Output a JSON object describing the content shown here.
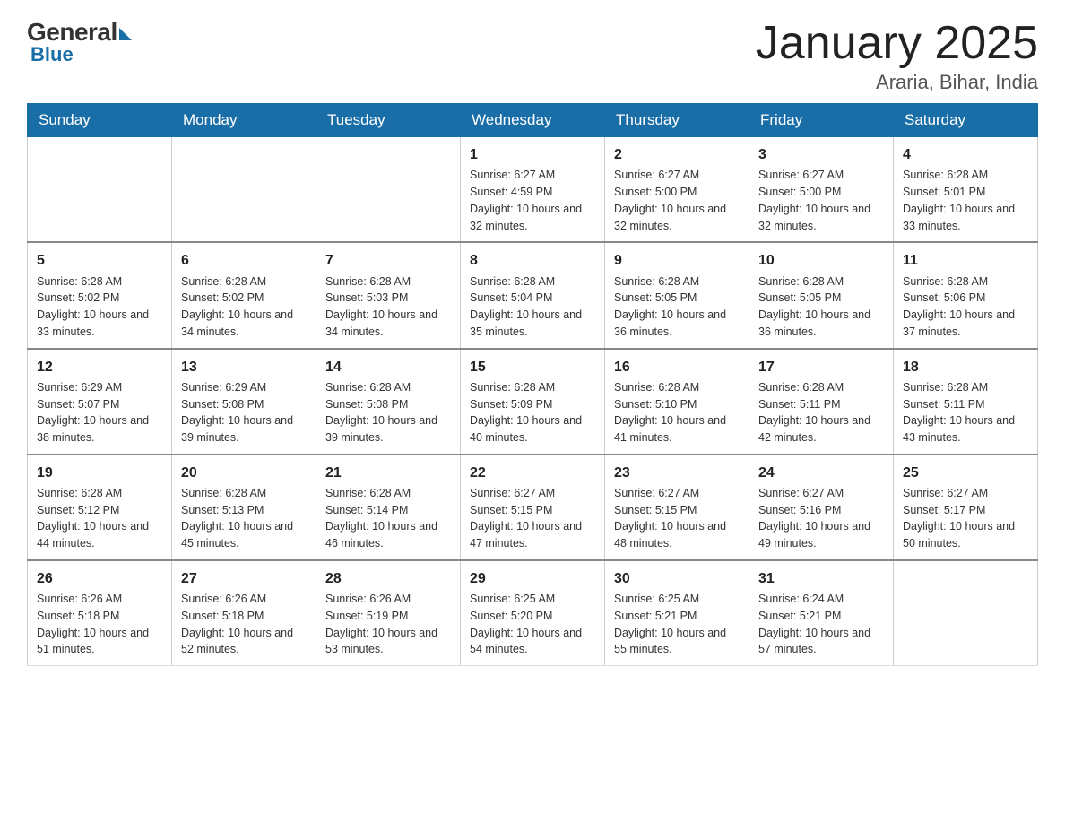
{
  "header": {
    "logo_general": "General",
    "logo_blue": "Blue",
    "month_title": "January 2025",
    "location": "Araria, Bihar, India"
  },
  "days_of_week": [
    "Sunday",
    "Monday",
    "Tuesday",
    "Wednesday",
    "Thursday",
    "Friday",
    "Saturday"
  ],
  "weeks": [
    [
      {
        "day": "",
        "info": ""
      },
      {
        "day": "",
        "info": ""
      },
      {
        "day": "",
        "info": ""
      },
      {
        "day": "1",
        "info": "Sunrise: 6:27 AM\nSunset: 4:59 PM\nDaylight: 10 hours\nand 32 minutes."
      },
      {
        "day": "2",
        "info": "Sunrise: 6:27 AM\nSunset: 5:00 PM\nDaylight: 10 hours\nand 32 minutes."
      },
      {
        "day": "3",
        "info": "Sunrise: 6:27 AM\nSunset: 5:00 PM\nDaylight: 10 hours\nand 32 minutes."
      },
      {
        "day": "4",
        "info": "Sunrise: 6:28 AM\nSunset: 5:01 PM\nDaylight: 10 hours\nand 33 minutes."
      }
    ],
    [
      {
        "day": "5",
        "info": "Sunrise: 6:28 AM\nSunset: 5:02 PM\nDaylight: 10 hours\nand 33 minutes."
      },
      {
        "day": "6",
        "info": "Sunrise: 6:28 AM\nSunset: 5:02 PM\nDaylight: 10 hours\nand 34 minutes."
      },
      {
        "day": "7",
        "info": "Sunrise: 6:28 AM\nSunset: 5:03 PM\nDaylight: 10 hours\nand 34 minutes."
      },
      {
        "day": "8",
        "info": "Sunrise: 6:28 AM\nSunset: 5:04 PM\nDaylight: 10 hours\nand 35 minutes."
      },
      {
        "day": "9",
        "info": "Sunrise: 6:28 AM\nSunset: 5:05 PM\nDaylight: 10 hours\nand 36 minutes."
      },
      {
        "day": "10",
        "info": "Sunrise: 6:28 AM\nSunset: 5:05 PM\nDaylight: 10 hours\nand 36 minutes."
      },
      {
        "day": "11",
        "info": "Sunrise: 6:28 AM\nSunset: 5:06 PM\nDaylight: 10 hours\nand 37 minutes."
      }
    ],
    [
      {
        "day": "12",
        "info": "Sunrise: 6:29 AM\nSunset: 5:07 PM\nDaylight: 10 hours\nand 38 minutes."
      },
      {
        "day": "13",
        "info": "Sunrise: 6:29 AM\nSunset: 5:08 PM\nDaylight: 10 hours\nand 39 minutes."
      },
      {
        "day": "14",
        "info": "Sunrise: 6:28 AM\nSunset: 5:08 PM\nDaylight: 10 hours\nand 39 minutes."
      },
      {
        "day": "15",
        "info": "Sunrise: 6:28 AM\nSunset: 5:09 PM\nDaylight: 10 hours\nand 40 minutes."
      },
      {
        "day": "16",
        "info": "Sunrise: 6:28 AM\nSunset: 5:10 PM\nDaylight: 10 hours\nand 41 minutes."
      },
      {
        "day": "17",
        "info": "Sunrise: 6:28 AM\nSunset: 5:11 PM\nDaylight: 10 hours\nand 42 minutes."
      },
      {
        "day": "18",
        "info": "Sunrise: 6:28 AM\nSunset: 5:11 PM\nDaylight: 10 hours\nand 43 minutes."
      }
    ],
    [
      {
        "day": "19",
        "info": "Sunrise: 6:28 AM\nSunset: 5:12 PM\nDaylight: 10 hours\nand 44 minutes."
      },
      {
        "day": "20",
        "info": "Sunrise: 6:28 AM\nSunset: 5:13 PM\nDaylight: 10 hours\nand 45 minutes."
      },
      {
        "day": "21",
        "info": "Sunrise: 6:28 AM\nSunset: 5:14 PM\nDaylight: 10 hours\nand 46 minutes."
      },
      {
        "day": "22",
        "info": "Sunrise: 6:27 AM\nSunset: 5:15 PM\nDaylight: 10 hours\nand 47 minutes."
      },
      {
        "day": "23",
        "info": "Sunrise: 6:27 AM\nSunset: 5:15 PM\nDaylight: 10 hours\nand 48 minutes."
      },
      {
        "day": "24",
        "info": "Sunrise: 6:27 AM\nSunset: 5:16 PM\nDaylight: 10 hours\nand 49 minutes."
      },
      {
        "day": "25",
        "info": "Sunrise: 6:27 AM\nSunset: 5:17 PM\nDaylight: 10 hours\nand 50 minutes."
      }
    ],
    [
      {
        "day": "26",
        "info": "Sunrise: 6:26 AM\nSunset: 5:18 PM\nDaylight: 10 hours\nand 51 minutes."
      },
      {
        "day": "27",
        "info": "Sunrise: 6:26 AM\nSunset: 5:18 PM\nDaylight: 10 hours\nand 52 minutes."
      },
      {
        "day": "28",
        "info": "Sunrise: 6:26 AM\nSunset: 5:19 PM\nDaylight: 10 hours\nand 53 minutes."
      },
      {
        "day": "29",
        "info": "Sunrise: 6:25 AM\nSunset: 5:20 PM\nDaylight: 10 hours\nand 54 minutes."
      },
      {
        "day": "30",
        "info": "Sunrise: 6:25 AM\nSunset: 5:21 PM\nDaylight: 10 hours\nand 55 minutes."
      },
      {
        "day": "31",
        "info": "Sunrise: 6:24 AM\nSunset: 5:21 PM\nDaylight: 10 hours\nand 57 minutes."
      },
      {
        "day": "",
        "info": ""
      }
    ]
  ]
}
